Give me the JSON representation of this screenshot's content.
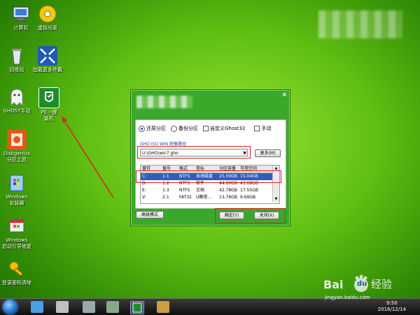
{
  "desktop": {
    "icons": [
      {
        "label": "计算机",
        "icon": "computer-icon"
      },
      {
        "label": "虚拟光驱",
        "icon": "virtual-drive-icon"
      },
      {
        "label": "回收站",
        "icon": "recycle-bin-icon"
      },
      {
        "label": "加载更多外置",
        "icon": "load-external-icon"
      },
      {
        "label": "GHOST手动",
        "icon": "ghost-icon"
      },
      {
        "label": "PE一键\n装机",
        "icon": "pe-install-icon"
      },
      {
        "label": "Diskgenius\n分区工具",
        "icon": "diskgenius-icon"
      },
      {
        "label": "Windows\n安装器",
        "icon": "windows-installer-icon"
      },
      {
        "label": "Windows\n启动引导修复",
        "icon": "boot-repair-icon"
      },
      {
        "label": "登录密码清除",
        "icon": "password-clear-icon"
      }
    ]
  },
  "dialog": {
    "close": "×",
    "options": {
      "restore": "还原分区",
      "backup": "备份分区",
      "custom_ghost": "自定义Ghost32",
      "manual": "手动"
    },
    "path_label": "GHO ISO WIN 映像路径",
    "path_value": "U:\\GHO\\win7.gho",
    "more_button": "更多(M)",
    "table": {
      "headers": [
        "盘符",
        "盘号",
        "格式",
        "卷标",
        "分区容量",
        "可用空间"
      ],
      "rows": [
        [
          "C:",
          "1:1",
          "NTFS",
          "本地磁盘",
          "25.00GB",
          "15.04GB"
        ],
        [
          "D:",
          "1:2",
          "NTFS",
          "软件",
          "44.00GB",
          "43.68GB"
        ],
        [
          "E:",
          "1:3",
          "NTFS",
          "文档",
          "42.78GB",
          "17.55GB"
        ],
        [
          "V:",
          "2:1",
          "FAT32",
          "U教授...",
          "13.76GB",
          "9.69GB"
        ]
      ]
    },
    "advanced_button": "高级模式",
    "ok_button": "确定(Y)",
    "close_button": "关闭(X)"
  },
  "taskbar": {
    "clock_time": "9:50",
    "clock_date": "2016/12/14"
  },
  "watermark": {
    "text": "经验",
    "site": "jingyan.baidu.com",
    "brand": "Bai",
    "brand2": "du"
  },
  "colors": {
    "highlight": "#e02020",
    "selection": "#2f5fb8"
  }
}
